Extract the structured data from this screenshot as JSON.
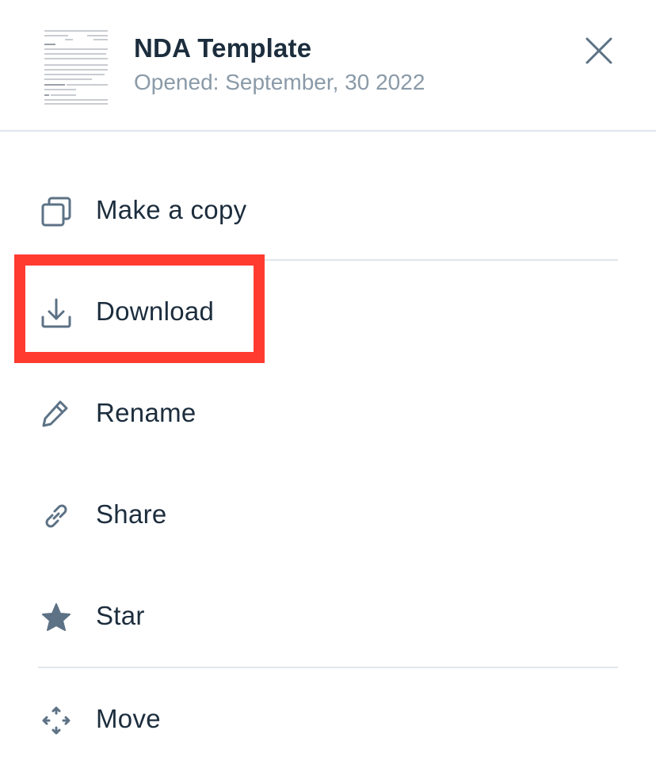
{
  "header": {
    "title": "NDA Template",
    "subtitle": "Opened: September, 30 2022",
    "thumbnail_icon": "document-thumbnail",
    "close_icon": "close-icon"
  },
  "menu": {
    "items": [
      {
        "label": "Make a copy",
        "icon": "copy-icon"
      },
      {
        "label": "Download",
        "icon": "download-icon"
      },
      {
        "label": "Rename",
        "icon": "pencil-icon"
      },
      {
        "label": "Share",
        "icon": "link-icon"
      },
      {
        "label": "Star",
        "icon": "star-icon"
      },
      {
        "label": "Move",
        "icon": "move-arrows-icon"
      }
    ]
  },
  "colors": {
    "text": "#1c2d3d",
    "subtext": "#8a9aa8",
    "icon": "#5d7285",
    "divider": "#dfe6ec",
    "highlight": "#ff3b30"
  }
}
